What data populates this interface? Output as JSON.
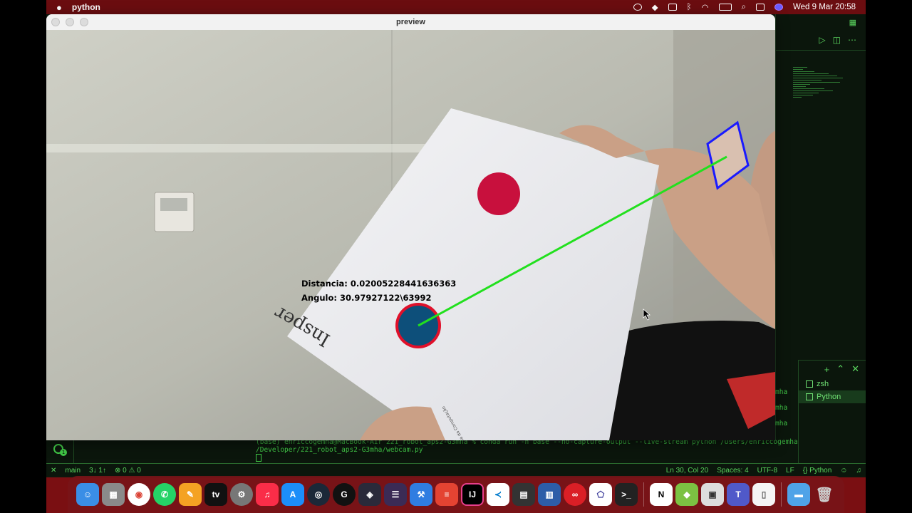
{
  "menubar": {
    "app_name": "python",
    "datetime": "Wed 9 Mar  20:58"
  },
  "window": {
    "title": "preview"
  },
  "overlay": {
    "distance_line": "Distancia: 0.02005228441636363",
    "angle_line": "Angulo: 30.97927122\\63992",
    "logo_text": "Insper",
    "paper_small_text": "Engenharia da Computação",
    "colors": {
      "line": "#22e01e",
      "target_circle": "#0d4f7a",
      "target_ring": "#e0102a",
      "red_dot": "#c8103d",
      "marker_box": "#1a1aff"
    }
  },
  "terminal": {
    "line1": "(base) enriccogemha@MacBook-Air 221_robot_aps2-G3mha % conda run -n base --no-capture-output --live-stream python /Users/enriccogemha",
    "line2": "/Developer/221_robot_aps2-G3mha/webcam.py",
    "right_fragments": [
      "mha",
      "mha",
      "mha"
    ],
    "sessions": [
      {
        "label": "zsh",
        "selected": false
      },
      {
        "label": "Python",
        "selected": true
      }
    ],
    "gear_badge": "1"
  },
  "statusbar": {
    "branch": "main",
    "sync": "3↓ 1↑",
    "problems": "⊗ 0 ⚠ 0",
    "position": "Ln 30, Col 20",
    "spaces": "Spaces: 4",
    "encoding": "UTF-8",
    "eol": "LF",
    "language": "{} Python"
  },
  "dock": {
    "apps": [
      "finder-icon",
      "launchpad-icon",
      "chrome-icon",
      "whatsapp-icon",
      "pages-icon",
      "tv-icon",
      "settings-icon",
      "music-icon",
      "appstore-icon",
      "steam-icon",
      "logitech-icon",
      "davinci-icon",
      "menubar-icon",
      "xcode-icon",
      "todoist-icon",
      "intellij-icon",
      "vscode-icon",
      "calculator-icon",
      "monitor-icon",
      "creativecloud-icon",
      "network-icon",
      "terminal-icon"
    ],
    "apps2": [
      "notion-icon",
      "box-icon",
      "preview-icon",
      "teams-icon",
      "document-icon"
    ],
    "apps3": [
      "downloads-folder-icon",
      "trash-icon"
    ],
    "labels": {
      "tv": "tv",
      "intellij": "IJ",
      "notion": "N"
    }
  }
}
